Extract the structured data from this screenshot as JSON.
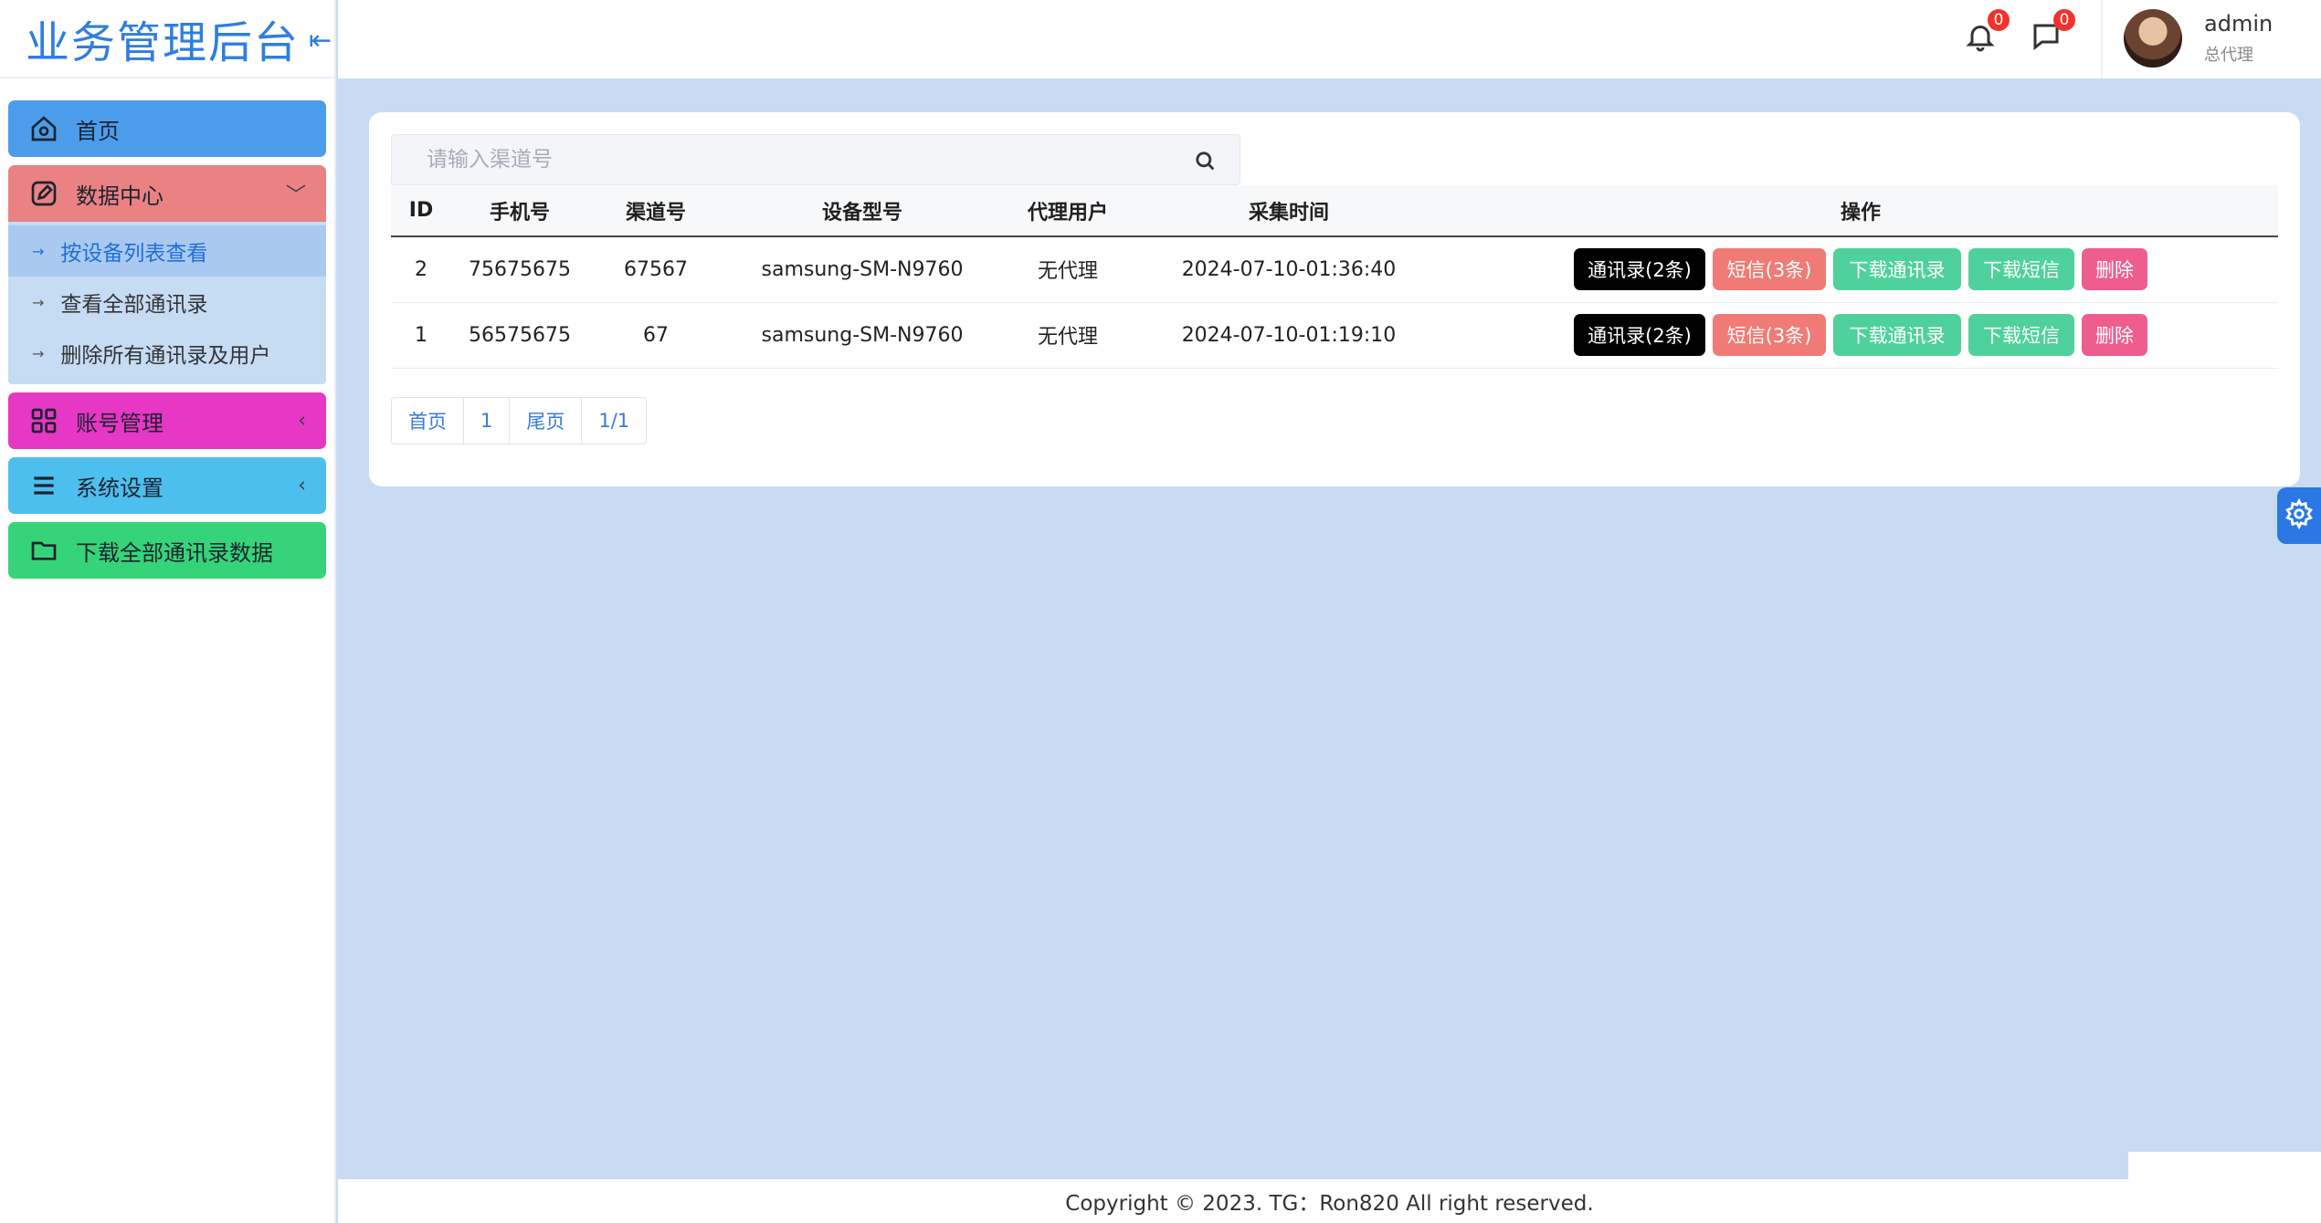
{
  "brand": {
    "title": "业务管理后台",
    "collapse_icon": "⇤"
  },
  "sidebar": {
    "items": [
      {
        "label": "首页",
        "icon": "home-icon"
      },
      {
        "label": "数据中心",
        "icon": "edit-icon",
        "caret": "﹀"
      },
      {
        "label": "账号管理",
        "icon": "grid-icon",
        "caret": "‹"
      },
      {
        "label": "系统设置",
        "icon": "menu-icon",
        "caret": "‹"
      },
      {
        "label": "下载全部通讯录数据",
        "icon": "folder-icon"
      }
    ],
    "submenu": [
      {
        "label": "按设备列表查看",
        "active": true
      },
      {
        "label": "查看全部通讯录",
        "active": false
      },
      {
        "label": "删除所有通讯录及用户",
        "active": false
      }
    ]
  },
  "header": {
    "notifications_count": "0",
    "messages_count": "0",
    "user_name": "admin",
    "user_role": "总代理"
  },
  "search": {
    "placeholder": "请输入渠道号"
  },
  "table": {
    "headers": [
      "ID",
      "手机号",
      "渠道号",
      "设备型号",
      "代理用户",
      "采集时间",
      "操作"
    ],
    "rows": [
      {
        "id": "2",
        "phone": "75675675",
        "channel": "67567",
        "device": "samsung-SM-N9760",
        "agent": "无代理",
        "time": "2024-07-10-01:36:40"
      },
      {
        "id": "1",
        "phone": "56575675",
        "channel": "67",
        "device": "samsung-SM-N9760",
        "agent": "无代理",
        "time": "2024-07-10-01:19:10"
      }
    ],
    "actions": {
      "contacts": "通讯录(2条)",
      "sms": "短信(3条)",
      "download_contacts": "下载通讯录",
      "download_sms": "下载短信",
      "delete": "删除"
    }
  },
  "pager": {
    "first": "首页",
    "page": "1",
    "last": "尾页",
    "info": "1/1"
  },
  "footer": {
    "copyright": "Copyright © 2023. TG：Ron820 All right reserved."
  },
  "colors": {
    "brand": "#2f7ee0",
    "home": "#4c9cec",
    "data": "#ea8284",
    "account": "#e637c5",
    "system": "#4dbfee",
    "download": "#36d47a",
    "background": "#c7dcf3"
  }
}
